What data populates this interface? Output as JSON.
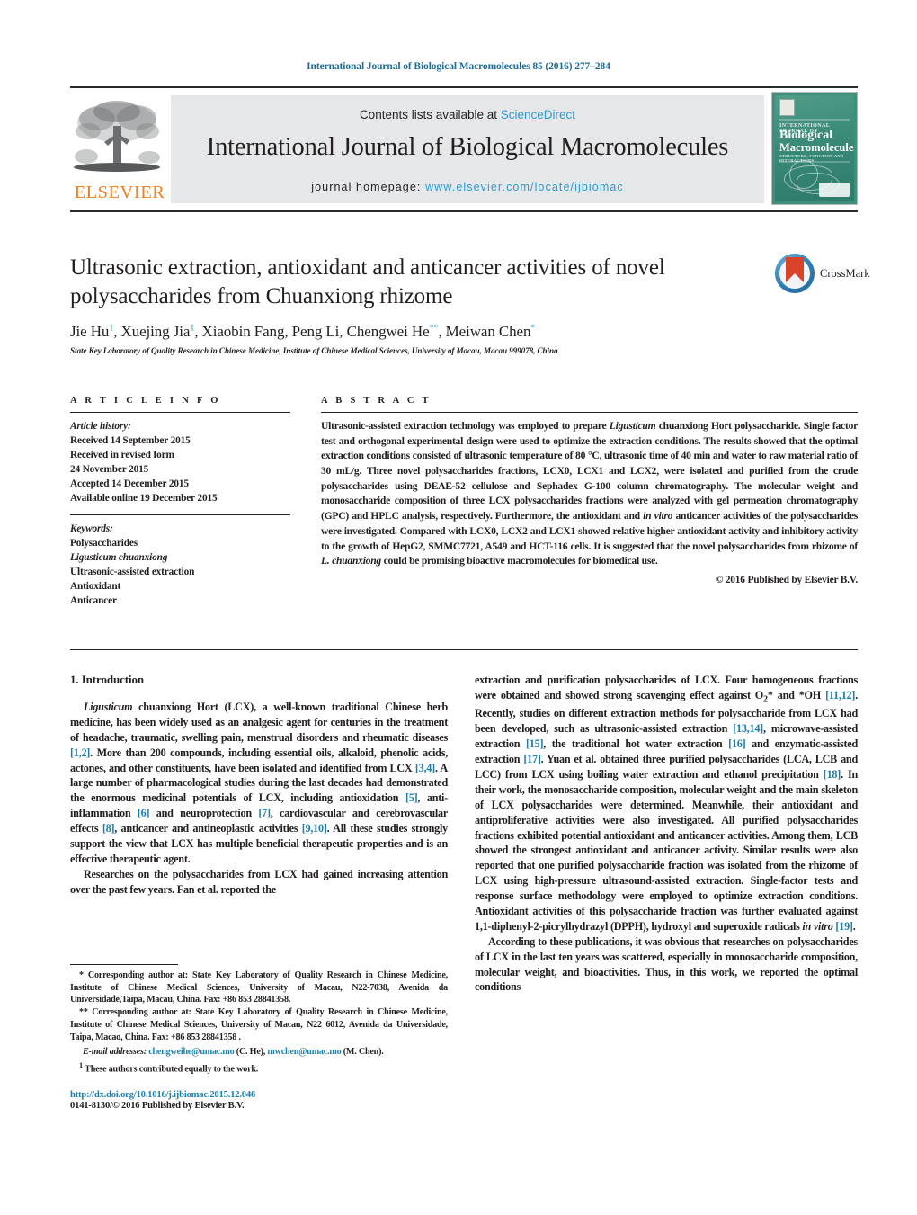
{
  "running_head": "International Journal of Biological Macromolecules 85 (2016) 277–284",
  "masthead": {
    "contents_prefix": "Contents lists available at ",
    "sciencedirect": "ScienceDirect",
    "journal_title": "International Journal of Biological Macromolecules",
    "homepage_label": "journal homepage: ",
    "homepage_url": "www.elsevier.com/locate/ijbiomac",
    "publisher_logo_text": "ELSEVIER",
    "cover": {
      "line_top": "INTERNATIONAL JOURNAL OF",
      "title_1": "Biological",
      "title_2": "Macromolecules",
      "subtitle": "STRUCTURE, FUNCTION AND INTERACTIONS",
      "badge": "ScienceDirect"
    },
    "accent_blue": "#2d9bd0",
    "elsevier_orange": "#f08020",
    "band_gray": "#e6e7e8"
  },
  "crossmark": {
    "label": "CrossMark"
  },
  "article": {
    "title": "Ultrasonic extraction, antioxidant and anticancer activities of novel polysaccharides from Chuanxiong rhizome",
    "authors_html": "Jie Hu<sup>1</sup>, Xuejing Jia<sup>1</sup>, Xiaobin Fang, Peng Li, Chengwei He<sup>**</sup>, Meiwan Chen<sup>*</sup>",
    "affiliation": "State Key Laboratory of Quality Research in Chinese Medicine, Institute of Chinese Medical Sciences, University of Macau, Macau 999078, China"
  },
  "article_info": {
    "heading": "A R T I C L E  I N F O",
    "history_label": "Article history:",
    "history": [
      "Received 14 September 2015",
      "Received in revised form",
      "24 November 2015",
      "Accepted 14 December 2015",
      "Available online 19 December 2015"
    ],
    "keywords_label": "Keywords:",
    "keywords": [
      "Polysaccharides",
      "Ligusticum chuanxiong",
      "Ultrasonic-assisted extraction",
      "Antioxidant",
      "Anticancer"
    ]
  },
  "abstract": {
    "heading": "A B S T R A C T",
    "text_html": "Ultrasonic-assisted extraction technology was employed to prepare <i>Ligusticum</i> chuanxiong Hort polysaccharide. Single factor test and orthogonal experimental design were used to optimize the extraction conditions. The results showed that the optimal extraction conditions consisted of ultrasonic temperature of 80 °C, ultrasonic time of 40 min and water to raw material ratio of 30 mL/g. Three novel polysaccharides fractions, LCX0, LCX1 and LCX2, were isolated and purified from the crude polysaccharides using DEAE-52 cellulose and Sephadex G-100 column chromatography. The molecular weight and monosaccharide composition of three LCX polysaccharides fractions were analyzed with gel permeation chromatography (GPC) and HPLC analysis, respectively. Furthermore, the antioxidant and <i>in vitro</i> anticancer activities of the polysaccharides were investigated. Compared with LCX0, LCX2 and LCX1 showed relative higher antioxidant activity and inhibitory activity to the growth of HepG2, SMMC7721, A549 and HCT-116 cells. It is suggested that the novel polysaccharides from rhizome of <i>L. chuanxiong</i> could be promising bioactive macromolecules for biomedical use.",
    "copyright": "© 2016 Published by Elsevier B.V."
  },
  "body": {
    "section_title": "1.  Introduction",
    "left_paragraphs_html": [
      "<i>Ligusticum</i> chuanxiong Hort (LCX), a well-known traditional Chinese herb medicine, has been widely used as an analgesic agent for centuries in the treatment of headache, traumatic, swelling pain, menstrual disorders and rheumatic diseases <span class=\"ref\">[1,2]</span>. More than 200 compounds, including essential oils, alkaloid, phenolic acids, actones, and other constituents, have been isolated and identified from LCX <span class=\"ref\">[3,4]</span>. A large number of pharmacological studies during the last decades had demonstrated the enormous medicinal potentials of LCX, including antioxidation <span class=\"ref\">[5]</span>, anti-inflammation <span class=\"ref\">[6]</span> and neuroprotection <span class=\"ref\">[7]</span>, cardiovascular and cerebrovascular effects <span class=\"ref\">[8]</span>, anticancer and antineoplastic activities <span class=\"ref\">[9,10]</span>. All these studies strongly support the view that LCX has multiple beneficial therapeutic properties and is an effective therapeutic agent.",
      "Researches on the polysaccharides from LCX had gained increasing attention over the past few years. Fan et al. reported the"
    ],
    "right_paragraphs_html": [
      "extraction and purification polysaccharides of LCX. Four homogeneous fractions were obtained and showed strong scavenging effect against O<sub>2</sub>* and *OH <span class=\"ref\">[11,12]</span>. Recently, studies on different extraction methods for polysaccharide from LCX had been developed, such as ultrasonic-assisted extraction <span class=\"ref\">[13,14]</span>, microwave-assisted extraction <span class=\"ref\">[15]</span>, the traditional hot water extraction <span class=\"ref\">[16]</span> and enzymatic-assisted extraction <span class=\"ref\">[17]</span>. Yuan et al. obtained three purified polysaccharides (LCA, LCB and LCC) from LCX using boiling water extraction and ethanol precipitation <span class=\"ref\">[18]</span>. In their work, the monosaccharide composition, molecular weight and the main skeleton of LCX polysaccharides were determined. Meanwhile, their antioxidant and antiproliferative activities were also investigated. All purified polysaccharides fractions exhibited potential antioxidant and anticancer activities. Among them, LCB showed the strongest antioxidant and anticancer activity. Similar results were also reported that one purified polysaccharide fraction was isolated from the rhizome of LCX using high-pressure ultrasound-assisted extraction. Single-factor tests and response surface methodology were employed to optimize extraction conditions. Antioxidant activities of this polysaccharide fraction was further evaluated against 1,1-diphenyl-2-picrylhydrazyl (DPPH), hydroxyl and superoxide radicals <i>in vitro</i> <span class=\"ref\">[19]</span>.",
      "According to these publications, it was obvious that researches on polysaccharides of LCX in the last ten years was scattered, especially in monosaccharide composition, molecular weight, and bioactivities. Thus, in this work, we reported the optimal conditions"
    ]
  },
  "footnotes": {
    "corresponding_1_html": "<span class=\"mark\">*</span> Corresponding author at: State Key Laboratory of Quality Research in Chinese Medicine, Institute of Chinese Medical Sciences, University of Macau, N22-7038, Avenida da Universidade,Taipa, Macau, China. Fax: +86 853 28841358.",
    "corresponding_2_html": "<span class=\"mark\">**</span> Corresponding author at: State Key Laboratory of Quality Research in Chinese Medicine, Institute of Chinese Medical Sciences, University of Macau, N22 6012, Avenida da Universidade, Taipa, Macao, China. Fax: +86 853 28841358 .",
    "email_html": "<span class=\"lbl\">E-mail addresses:</span> <span class=\"link\">chengweihe@umac.mo</span> (C. He), <span class=\"link\">mwchen@umac.mo</span> (M. Chen).",
    "contrib_html": "<sup>1</sup> These authors contributed equally to the work."
  },
  "footer": {
    "doi": "http://dx.doi.org/10.1016/j.ijbiomac.2015.12.046",
    "issn": "0141-8130/© 2016 Published by Elsevier B.V."
  }
}
